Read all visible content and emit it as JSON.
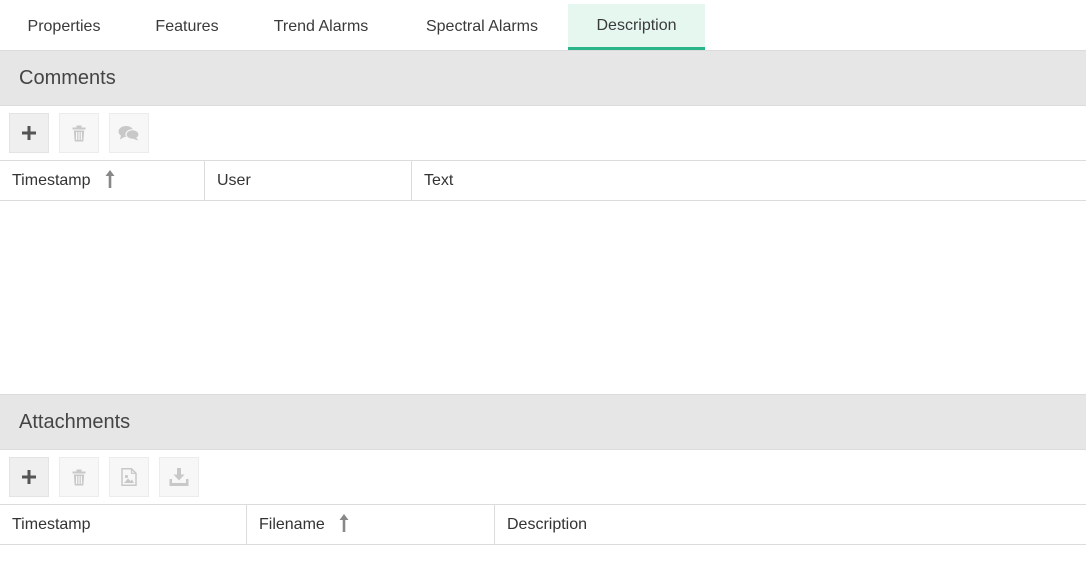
{
  "tabs": [
    {
      "label": "Properties",
      "active": false
    },
    {
      "label": "Features",
      "active": false
    },
    {
      "label": "Trend Alarms",
      "active": false
    },
    {
      "label": "Spectral Alarms",
      "active": false
    },
    {
      "label": "Description",
      "active": true
    }
  ],
  "comments": {
    "title": "Comments",
    "toolbar": [
      {
        "icon": "plus-icon",
        "enabled": true
      },
      {
        "icon": "trash-icon",
        "enabled": false
      },
      {
        "icon": "speech-bubbles-icon",
        "enabled": false
      }
    ],
    "columns": [
      {
        "label": "Timestamp",
        "sorted": "asc"
      },
      {
        "label": "User",
        "sorted": null
      },
      {
        "label": "Text",
        "sorted": null
      }
    ],
    "rows": []
  },
  "attachments": {
    "title": "Attachments",
    "toolbar": [
      {
        "icon": "plus-icon",
        "enabled": true
      },
      {
        "icon": "trash-icon",
        "enabled": false
      },
      {
        "icon": "image-file-icon",
        "enabled": false
      },
      {
        "icon": "download-icon",
        "enabled": false
      }
    ],
    "columns": [
      {
        "label": "Timestamp",
        "sorted": null
      },
      {
        "label": "Filename",
        "sorted": "asc"
      },
      {
        "label": "Description",
        "sorted": null
      }
    ],
    "rows": []
  },
  "colors": {
    "accent": "#2bb389",
    "active_tab_bg": "#e6f7f0",
    "section_bg": "#e6e6e6",
    "border": "#dcdcdc"
  }
}
